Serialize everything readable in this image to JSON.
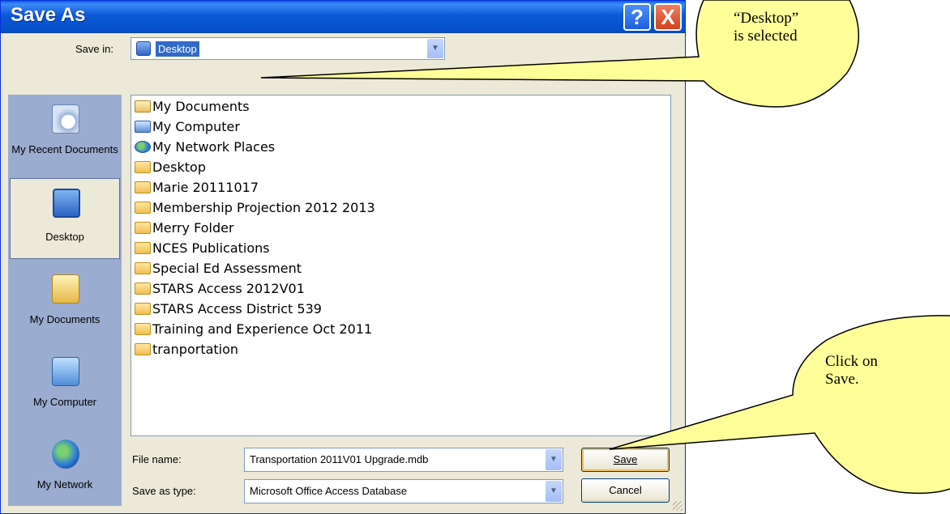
{
  "window": {
    "title": "Save As",
    "help_glyph": "?",
    "close_glyph": "X"
  },
  "save_in": {
    "label": "Save in:",
    "value": "Desktop"
  },
  "places": [
    {
      "label": "My Recent Documents",
      "icon": "recent-documents-icon"
    },
    {
      "label": "Desktop",
      "icon": "desktop-icon",
      "selected": true
    },
    {
      "label": "My Documents",
      "icon": "my-documents-icon"
    },
    {
      "label": "My Computer",
      "icon": "my-computer-icon"
    },
    {
      "label": "My Network",
      "icon": "my-network-icon"
    }
  ],
  "files": [
    {
      "name": "My Documents",
      "icon": "my-documents-icon"
    },
    {
      "name": "My Computer",
      "icon": "my-computer-icon"
    },
    {
      "name": "My Network Places",
      "icon": "my-network-places-icon"
    },
    {
      "name": "Desktop",
      "icon": "folder-icon"
    },
    {
      "name": "Marie 20111017",
      "icon": "folder-icon"
    },
    {
      "name": "Membership Projection 2012 2013",
      "icon": "folder-icon"
    },
    {
      "name": "Merry Folder",
      "icon": "folder-icon"
    },
    {
      "name": "NCES Publications",
      "icon": "folder-icon"
    },
    {
      "name": "Special Ed Assessment",
      "icon": "folder-icon"
    },
    {
      "name": "STARS Access 2012V01",
      "icon": "folder-icon"
    },
    {
      "name": "STARS Access District 539",
      "icon": "folder-icon"
    },
    {
      "name": "Training and Experience Oct 2011",
      "icon": "folder-icon"
    },
    {
      "name": "tranportation",
      "icon": "folder-icon"
    }
  ],
  "file_name": {
    "label": "File name:",
    "value": "Transportation 2011V01 Upgrade.mdb"
  },
  "save_as_type": {
    "label": "Save as type:",
    "value": "Microsoft Office Access Database"
  },
  "buttons": {
    "save": "Save",
    "cancel": "Cancel"
  },
  "callouts": {
    "top": [
      "“Desktop”",
      "is selected"
    ],
    "bottom": [
      "Click on",
      "Save."
    ]
  },
  "colors": {
    "titlebar": "#0a5ee0",
    "selection": "#316ac5",
    "callout_fill": "#ffff99",
    "dialog_bg": "#ece9d8"
  }
}
